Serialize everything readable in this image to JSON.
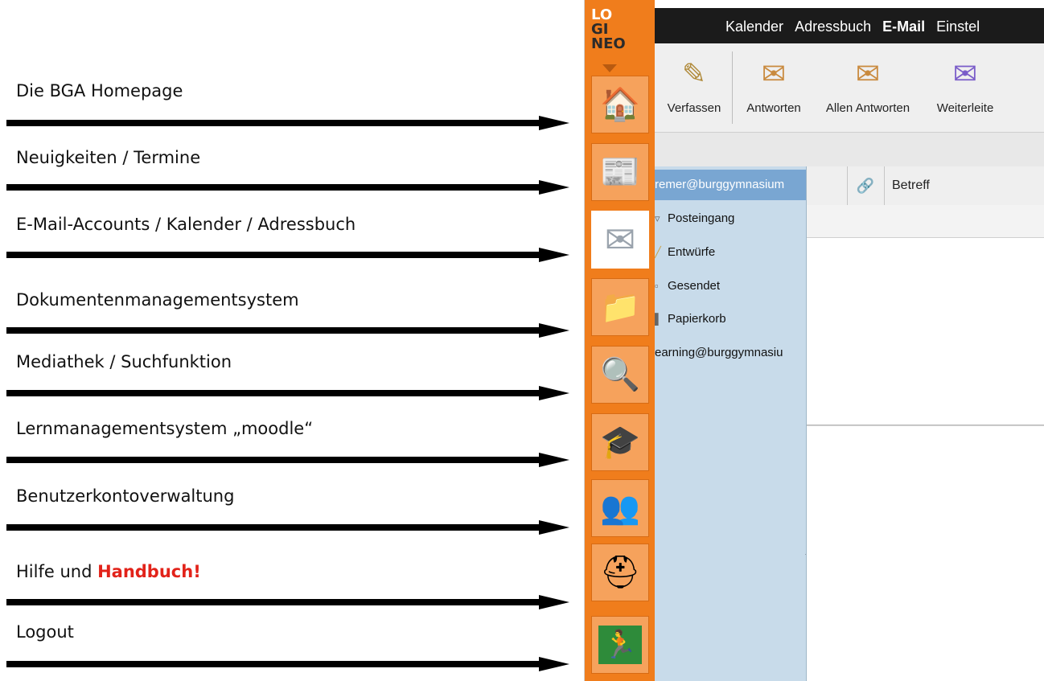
{
  "annotations": [
    {
      "label": "Die BGA Homepage",
      "highlight": ""
    },
    {
      "label": "Neuigkeiten / Termine",
      "highlight": ""
    },
    {
      "label": "E-Mail-Accounts / Kalender / Adressbuch",
      "highlight": ""
    },
    {
      "label": "Dokumentenmanagementsystem",
      "highlight": ""
    },
    {
      "label": "Mediathek / Suchfunktion",
      "highlight": ""
    },
    {
      "label": "Lernmanagementsystem „moodle“",
      "highlight": ""
    },
    {
      "label": "Benutzerkontoverwaltung",
      "highlight": ""
    },
    {
      "label": "Hilfe und ",
      "highlight": "Handbuch!"
    },
    {
      "label": "Logout",
      "highlight": ""
    }
  ],
  "app": {
    "logo": {
      "line1": "LO",
      "line2": "GI",
      "line3": "NEO"
    },
    "rail": [
      {
        "name": "home",
        "icon": "house-icon",
        "glyph": "🏠"
      },
      {
        "name": "news",
        "icon": "newspaper-icon",
        "glyph": "📰"
      },
      {
        "name": "mail",
        "icon": "envelope-icon",
        "glyph": "✉"
      },
      {
        "name": "documents",
        "icon": "folder-icon",
        "glyph": "📁"
      },
      {
        "name": "search",
        "icon": "magnifier-icon",
        "glyph": "🔍"
      },
      {
        "name": "moodle",
        "icon": "moodle-icon",
        "glyph": "🎓"
      },
      {
        "name": "accounts",
        "icon": "users-icon",
        "glyph": "👥"
      },
      {
        "name": "help",
        "icon": "lifebuoy-icon",
        "glyph": "⛑"
      },
      {
        "name": "logout",
        "icon": "exit-icon",
        "glyph": "🏃"
      }
    ],
    "topnav": {
      "calendar": "Kalender",
      "addressbook": "Adressbuch",
      "email": "E-Mail",
      "settings": "Einstel"
    },
    "toolbar": {
      "compose": "Verfassen",
      "reply": "Antworten",
      "reply_all": "Allen Antworten",
      "forward": "Weiterleite"
    },
    "folders": {
      "account1": "remer@burggymnasium",
      "inbox": "Posteingang",
      "drafts": "Entwürfe",
      "sent": "Gesendet",
      "trash": "Papierkorb",
      "account2": "earning@burggymnasiu"
    },
    "grid": {
      "subject_header": "Betreff"
    }
  }
}
